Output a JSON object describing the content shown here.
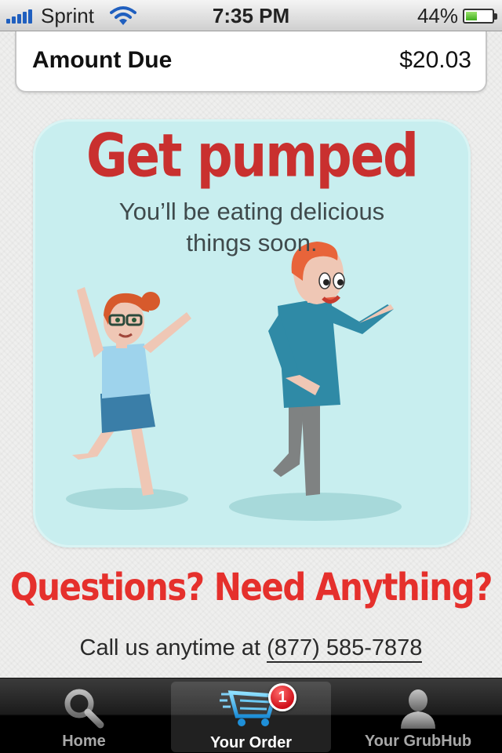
{
  "status_bar": {
    "carrier": "Sprint",
    "time": "7:35 PM",
    "battery_percent": "44%",
    "battery_level": 0.44
  },
  "order": {
    "amount_due_label": "Amount Due",
    "amount_due_value": "$20.03"
  },
  "promo": {
    "title": "Get pumped",
    "subtitle_line1": "You’ll be eating delicious",
    "subtitle_line2": "things soon."
  },
  "support": {
    "heading": "Questions? Need Anything?",
    "call_text": "Call us anytime at",
    "phone": "(877) 585-7878"
  },
  "tabs": [
    {
      "label": "Home",
      "icon": "search-icon",
      "active": false
    },
    {
      "label": "Your Order",
      "icon": "cart-icon",
      "active": true,
      "badge": "1"
    },
    {
      "label": "Your GrubHub",
      "icon": "person-icon",
      "active": false
    }
  ],
  "colors": {
    "accent_red": "#e5302c",
    "promo_bg": "#c8eeef",
    "tab_active_label": "#ffffff"
  }
}
